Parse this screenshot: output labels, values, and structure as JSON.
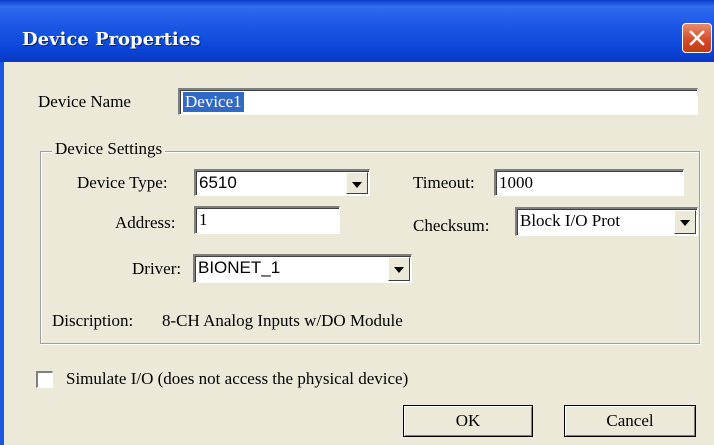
{
  "window": {
    "title": "Device Properties"
  },
  "device_name": {
    "label": "Device Name",
    "value": "Device1"
  },
  "device_settings": {
    "legend": "Device Settings",
    "device_type": {
      "label": "Device Type:",
      "value": "6510"
    },
    "timeout": {
      "label": "Timeout:",
      "value": "1000"
    },
    "address": {
      "label": "Address:",
      "value": "1"
    },
    "checksum": {
      "label": "Checksum:",
      "value": "Block I/O Prot"
    },
    "driver": {
      "label": "Driver:",
      "value": "BIONET_1"
    },
    "description": {
      "label": "Discription:",
      "value": "8-CH Analog Inputs w/DO Module"
    }
  },
  "simulate": {
    "label": "Simulate I/O (does not access the physical device)",
    "checked": false
  },
  "buttons": {
    "ok": "OK",
    "cancel": "Cancel"
  },
  "icons": {
    "close": "close-icon",
    "dropdown": "chevron-down-icon"
  }
}
